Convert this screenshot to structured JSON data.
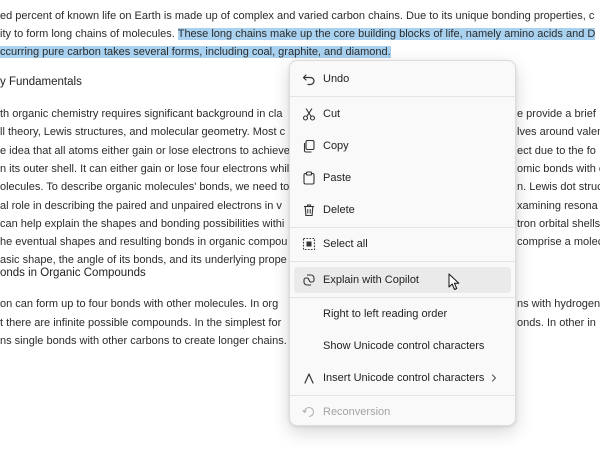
{
  "document": {
    "paragraph1": {
      "line1": "ed percent of known life on Earth is made up of complex and varied carbon chains. Due to its unique bonding properties, c",
      "line2_plain": "ity to form long chains of molecules. ",
      "line2_selected": "These long chains make up the core building blocks of life, namely amino acids and D",
      "line3_selected": "ccurring pure carbon takes several forms, including coal, graphite, and diamond."
    },
    "heading1": "y Fundamentals",
    "paragraph2": [
      {
        "left": "th organic chemistry requires significant background in cla",
        "right": "e provide a brief"
      },
      {
        "left": "ll theory, Lewis structures, and molecular geometry. Most c",
        "right": "lves around valen"
      },
      {
        "left": "e idea that all atoms either gain or lose electrons to achieve",
        "right": "ect due to the fo"
      },
      {
        "left": "n its outer shell. It can either gain or lose four electrons whil",
        "right": "omic bonds with c"
      },
      {
        "left": "olecules. To describe organic molecules' bonds, we need to",
        "right": "n. Lewis dot struc"
      },
      {
        "left": "al role in describing the paired and unpaired electrons in v",
        "right": "xamining resona"
      },
      {
        "left": "can help explain the shapes and bonding possibilities withi",
        "right": "tron orbital shells"
      },
      {
        "left": "he eventual shapes and resulting bonds in organic compou",
        "right": "comprise a molec"
      },
      {
        "left": "asic shape, the angle of its bonds, and its underlying prope",
        "right": ""
      }
    ],
    "heading2": "onds in Organic Compounds",
    "paragraph3": [
      {
        "left": "on can form up to four bonds with other molecules. In org",
        "right": "ns with hydrogen"
      },
      {
        "left": "t there are infinite possible compounds. In the simplest for",
        "right": "onds. In other in"
      },
      {
        "left": "ns single bonds with other carbons to create longer chains.",
        "right": ""
      }
    ]
  },
  "context_menu": {
    "items": {
      "undo": {
        "label": "Undo",
        "icon": "undo-icon"
      },
      "cut": {
        "label": "Cut",
        "icon": "scissors-icon"
      },
      "copy": {
        "label": "Copy",
        "icon": "copy-icon"
      },
      "paste": {
        "label": "Paste",
        "icon": "paste-icon"
      },
      "delete": {
        "label": "Delete",
        "icon": "trash-icon"
      },
      "select_all": {
        "label": "Select all",
        "icon": "select-all-icon"
      },
      "explain": {
        "label": "Explain with Copilot",
        "icon": "copilot-icon"
      },
      "rtl": {
        "label": "Right to left reading order"
      },
      "show_unicode": {
        "label": "Show Unicode control characters"
      },
      "insert_unicode": {
        "label": "Insert Unicode control characters",
        "icon": "insert-caret-icon"
      },
      "reconversion": {
        "label": "Reconversion",
        "icon": "reconversion-icon"
      }
    }
  },
  "colors": {
    "selection": "#a9d2f0",
    "menu_background": "#f9f9f9",
    "hover": "#eaeaea",
    "disabled_text": "#a3a3a3"
  }
}
